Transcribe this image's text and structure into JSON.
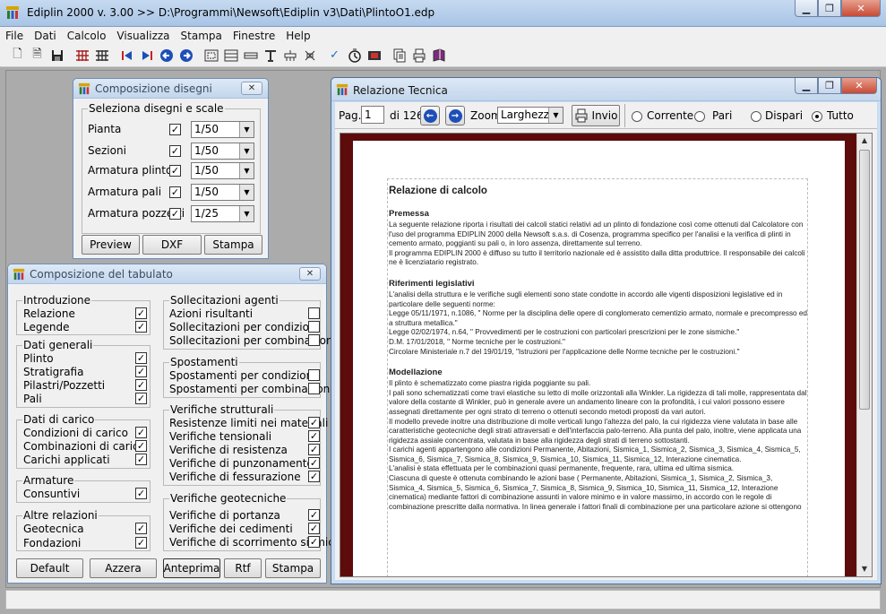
{
  "window": {
    "title": "Ediplin 2000 v. 3.00 >> D:\\Programmi\\Newsoft\\Ediplin v3\\Dati\\PlintoO1.edp",
    "minimize": "▁",
    "maximize": "❐",
    "close": "✕"
  },
  "menu": [
    "File",
    "Dati",
    "Calcolo",
    "Visualizza",
    "Stampa",
    "Finestre",
    "Help"
  ],
  "toolbar_icons": [
    "new-icon",
    "open-icon",
    "save-icon",
    "grid-icon",
    "grid-alt-icon",
    "first-icon",
    "last-icon",
    "prev-icon",
    "next-icon",
    "fit-icon",
    "table-icon",
    "beam-icon",
    "column-icon",
    "plinth-icon",
    "check-icon",
    "clock-icon",
    "film-icon",
    "copy-icon",
    "print-icon",
    "book-icon"
  ],
  "composizione_disegni": {
    "title": "Composizione disegni",
    "group_title": "Seleziona disegni e scale",
    "rows": [
      {
        "label": "Pianta",
        "checked": "✓",
        "scale": "1/50"
      },
      {
        "label": "Sezioni",
        "checked": "✓",
        "scale": "1/50"
      },
      {
        "label": "Armatura plinto",
        "checked": "✓",
        "scale": "1/50"
      },
      {
        "label": "Armatura pali",
        "checked": "✓",
        "scale": "1/50"
      },
      {
        "label": "Armatura pozzetti",
        "checked": "✓",
        "scale": "1/25"
      }
    ],
    "buttons": {
      "preview": "Preview",
      "dxf": "DXF",
      "stampa": "Stampa"
    }
  },
  "composizione_tabulato": {
    "title": "Composizione del tabulato",
    "groups": {
      "introduzione": {
        "title": "Introduzione",
        "items": [
          {
            "label": "Relazione",
            "checked": "✓"
          },
          {
            "label": "Legende",
            "checked": "✓"
          }
        ]
      },
      "dati_generali": {
        "title": "Dati generali",
        "items": [
          {
            "label": "Plinto",
            "checked": "✓"
          },
          {
            "label": "Stratigrafia",
            "checked": "✓"
          },
          {
            "label": "Pilastri/Pozzetti",
            "checked": "✓"
          },
          {
            "label": "Pali",
            "checked": "✓"
          }
        ]
      },
      "dati_carico": {
        "title": "Dati di carico",
        "items": [
          {
            "label": "Condizioni di carico",
            "checked": "✓"
          },
          {
            "label": "Combinazioni di carico",
            "checked": "✓"
          },
          {
            "label": "Carichi applicati",
            "checked": "✓"
          }
        ]
      },
      "armature": {
        "title": "Armature",
        "items": [
          {
            "label": "Consuntivi",
            "checked": "✓"
          }
        ]
      },
      "altre_relazioni": {
        "title": "Altre relazioni",
        "items": [
          {
            "label": "Geotecnica",
            "checked": "✓"
          },
          {
            "label": "Fondazioni",
            "checked": "✓"
          }
        ]
      },
      "sollecitazioni": {
        "title": "Sollecitazioni agenti",
        "items": [
          {
            "label": "Azioni risultanti",
            "checked": ""
          },
          {
            "label": "Sollecitazioni per condizioni",
            "checked": ""
          },
          {
            "label": "Sollecitazioni per combinazioni",
            "checked": ""
          }
        ]
      },
      "spostamenti": {
        "title": "Spostamenti",
        "items": [
          {
            "label": "Spostamenti per condizioni",
            "checked": ""
          },
          {
            "label": "Spostamenti per combinazioni",
            "checked": ""
          }
        ]
      },
      "verifiche_strutturali": {
        "title": "Verifiche strutturali",
        "items": [
          {
            "label": "Resistenze limiti nei materiali",
            "checked": "✓"
          },
          {
            "label": "Verifiche tensionali",
            "checked": "✓"
          },
          {
            "label": "Verifiche di resistenza",
            "checked": "✓"
          },
          {
            "label": "Verifiche di punzonamento",
            "checked": "✓"
          },
          {
            "label": "Verifiche di fessurazione",
            "checked": "✓"
          }
        ]
      },
      "verifiche_geotecniche": {
        "title": "Verifiche geotecniche",
        "items": [
          {
            "label": "Verifiche di portanza",
            "checked": "✓"
          },
          {
            "label": "Verifiche dei cedimenti",
            "checked": "✓"
          },
          {
            "label": "Verifiche di scorrimento sismico",
            "checked": "✓"
          }
        ]
      }
    },
    "buttons": {
      "default": "Default",
      "azzera": "Azzera",
      "anteprima": "Anteprima",
      "rtf": "Rtf",
      "stampa": "Stampa"
    }
  },
  "relazione_tecnica": {
    "title": "Relazione Tecnica",
    "pag_label": "Pag.",
    "page_value": "1",
    "of_label": "di 126",
    "zoom_label": "Zoom",
    "zoom_value": "Larghezza",
    "invio_label": "Invio",
    "radios": [
      {
        "label": "Corrente",
        "on": false
      },
      {
        "label": "Pari",
        "on": false
      },
      {
        "label": "Dispari",
        "on": false
      },
      {
        "label": "Tutto",
        "on": true
      }
    ],
    "doc": {
      "heading": "Relazione di calcolo",
      "sections": [
        {
          "title": "Premessa",
          "paras": [
            "La seguente relazione riporta i risultati dei calcoli statici relativi ad un plinto di fondazione così come ottenuti dal Calcolatore con l'uso del programma EDIPLIN 2000 della Newsoft s.a.s. di Cosenza, programma specifico per l'analisi e la verifica di plinti in cemento armato, poggianti su pali o, in loro assenza, direttamente sul terreno.",
            "Il programma EDIPLIN 2000 è diffuso su tutto il territorio nazionale ed è assistito dalla ditta produttrice. Il responsabile dei calcoli ne è licenziatario registrato."
          ]
        },
        {
          "title": "Riferimenti legislativi",
          "paras": [
            "L'analisi della struttura e le verifiche sugli elementi sono state condotte in accordo alle vigenti disposizioni legislative ed in particolare delle seguenti norme:",
            "Legge 05/11/1971, n.1086, \" Norme per la disciplina delle opere di conglomerato cementizio armato, normale e precompresso ed a struttura metallica.\"",
            "Legge 02/02/1974, n.64, \" Provvedimenti per le costruzioni con particolari prescrizioni per le zone sismiche.\"",
            "D.M. 17/01/2018, \" Norme tecniche per le costruzioni.\"",
            "Circolare Ministeriale n.7 del 19/01/19, \"Istruzioni per l'applicazione delle Norme tecniche per le costruzioni.\""
          ]
        },
        {
          "title": "Modellazione",
          "paras": [
            "Il plinto è schematizzato come piastra rigida poggiante su pali.",
            "I pali sono schematizzati come travi elastiche su letto di molle orizzontali alla Winkler. La rigidezza di tali molle, rappresentata dal valore della costante di Winkler, può in generale avere un andamento lineare con la profondità, i cui valori possono essere assegnati direttamente per ogni strato di terreno o ottenuti secondo metodi proposti da vari autori.",
            "Il modello prevede inoltre una distribuzione di molle verticali lungo l'altezza del palo, la cui rigidezza viene valutata in base alle caratteristiche geotecniche degli strati attraversati e dell'interfaccia palo-terreno. Alla punta del palo, inoltre, viene applicata una rigidezza assiale concentrata, valutata in base alla rigidezza degli strati di terreno sottostanti.",
            "I carichi agenti appartengono alle condizioni Permanente, Abitazioni, Sismica_1, Sismica_2, Sismica_3, Sismica_4, Sismica_5, Sismica_6, Sismica_7, Sismica_8, Sismica_9, Sismica_10, Sismica_11, Sismica_12, Interazione cinematica.",
            "L'analisi è stata effettuata per le combinazioni quasi permanente, frequente, rara, ultima ed ultima sismica.",
            "Ciascuna di queste è ottenuta combinando le azioni base ( Permanente, Abitazioni, Sismica_1, Sismica_2, Sismica_3, Sismica_4, Sismica_5, Sismica_6, Sismica_7, Sismica_8, Sismica_9, Sismica_10, Sismica_11, Sismica_12, Interazione cinematica) mediante fattori di combinazione assunti in valore minimo e in valore massimo, in accordo con le regole di combinazione prescritte dalla normativa. In linea generale i fattori finali di combinazione per una particolare azione si ottengono"
          ]
        }
      ]
    }
  }
}
